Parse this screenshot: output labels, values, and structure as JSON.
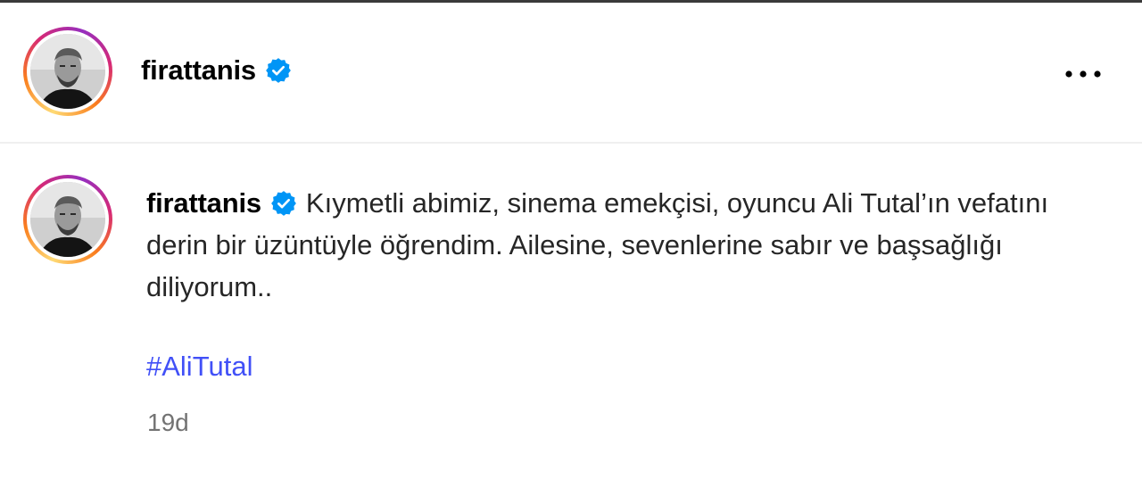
{
  "post_header": {
    "username": "firattanis",
    "verified": true,
    "more_icon": "more-horizontal-icon"
  },
  "comment": {
    "username": "firattanis",
    "verified": true,
    "text": "Kıymetli abimiz, sinema emekçisi, oyuncu Ali Tutal’ın vefatını derin bir üzüntüyle öğrendim. Ailesine, sevenlerine sabır ve başsağlığı diliyorum..",
    "hashtag": "#AliTutal",
    "timestamp": "19d"
  },
  "colors": {
    "verified_badge": "#0095f6",
    "hashtag": "#4150f7",
    "muted_text": "#737373",
    "divider": "#efefef"
  }
}
